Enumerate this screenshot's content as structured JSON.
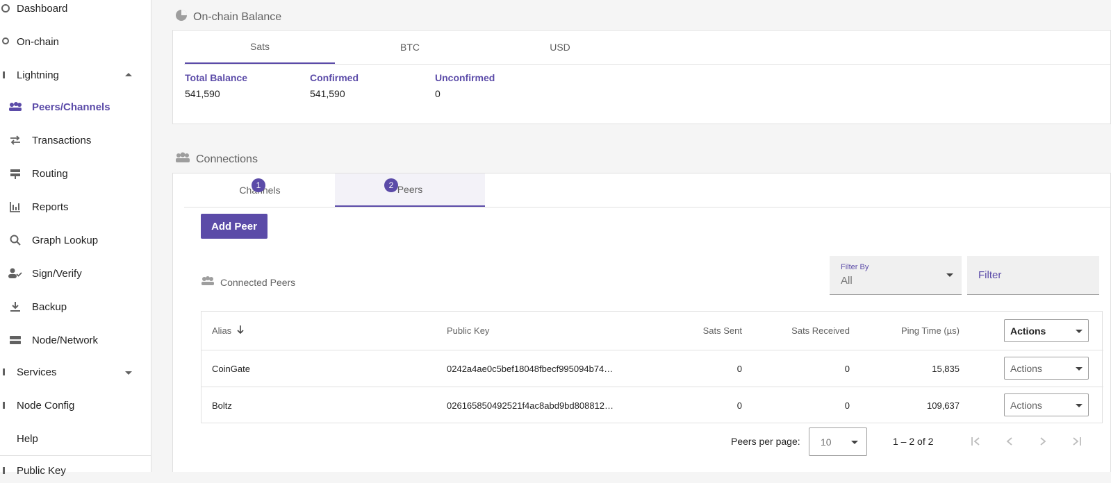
{
  "sidebar": {
    "items": [
      {
        "label": "Dashboard"
      },
      {
        "label": "On-chain"
      },
      {
        "label": "Lightning"
      },
      {
        "label": "Peers/Channels"
      },
      {
        "label": "Transactions"
      },
      {
        "label": "Routing"
      },
      {
        "label": "Reports"
      },
      {
        "label": "Graph Lookup"
      },
      {
        "label": "Sign/Verify"
      },
      {
        "label": "Backup"
      },
      {
        "label": "Node/Network"
      },
      {
        "label": "Services"
      },
      {
        "label": "Node Config"
      },
      {
        "label": "Help"
      },
      {
        "label": "Public Key"
      }
    ]
  },
  "onchain": {
    "title": "On-chain Balance",
    "tabs": [
      "Sats",
      "BTC",
      "USD"
    ],
    "total_label": "Total Balance",
    "total_value": "541,590",
    "confirmed_label": "Confirmed",
    "confirmed_value": "541,590",
    "unconfirmed_label": "Unconfirmed",
    "unconfirmed_value": "0"
  },
  "connections": {
    "title": "Connections",
    "tabs": [
      {
        "label": "Channels",
        "count": "1"
      },
      {
        "label": "Peers",
        "count": "2"
      }
    ],
    "add_peer": "Add Peer",
    "connected_peers": "Connected Peers",
    "filter_by_label": "Filter By",
    "filter_by_value": "All",
    "filter_placeholder": "Filter",
    "columns": {
      "alias": "Alias",
      "pubkey": "Public Key",
      "sent": "Sats Sent",
      "received": "Sats Received",
      "ping": "Ping Time (µs)",
      "actions": "Actions"
    },
    "rows": [
      {
        "alias": "CoinGate",
        "pubkey": "0242a4ae0c5bef18048fbecf995094b74…",
        "sent": "0",
        "received": "0",
        "ping": "15,835",
        "actions": "Actions"
      },
      {
        "alias": "Boltz",
        "pubkey": "026165850492521f4ac8abd9bd808812…",
        "sent": "0",
        "received": "0",
        "ping": "109,637",
        "actions": "Actions"
      }
    ],
    "pager": {
      "per_page_label": "Peers per page:",
      "per_page_value": "10",
      "range": "1 – 2 of 2"
    }
  },
  "colors": {
    "accent": "#5b4ba8"
  }
}
